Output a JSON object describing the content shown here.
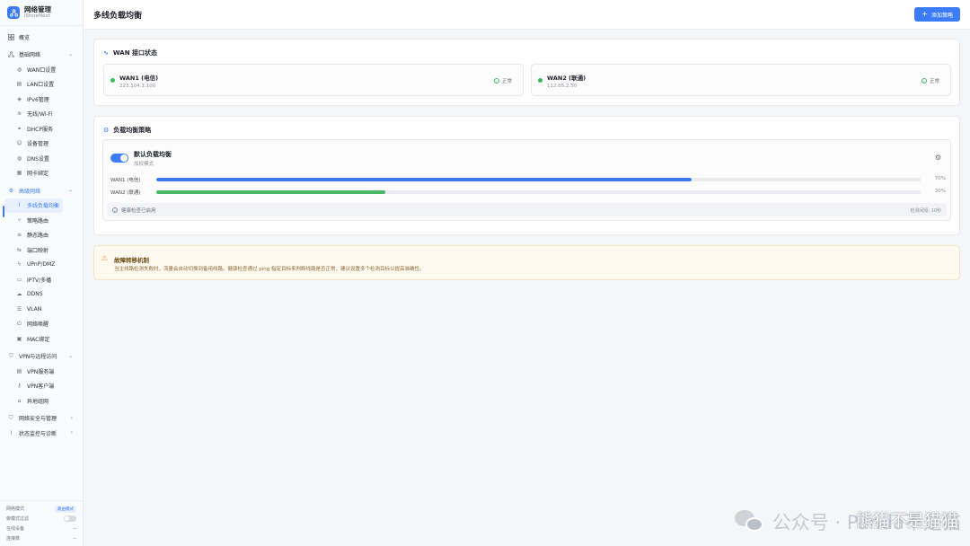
{
  "brand": {
    "title": "网络管理",
    "subtitle": "iStoreNext"
  },
  "sidebar": {
    "overview": "概览",
    "basic": {
      "label": "基础网络",
      "items": [
        "WAN口设置",
        "LAN口设置",
        "IPv6管理",
        "无线/Wi-Fi",
        "DHCP服务",
        "设备管理",
        "DNS设置",
        "网卡绑定"
      ]
    },
    "advanced": {
      "label": "高级网络",
      "items": [
        "多线负载均衡",
        "策略路由",
        "静态路由",
        "端口映射",
        "UPnP/DMZ",
        "IPTV/多播",
        "DDNS",
        "VLAN",
        "网络唤醒",
        "MAC绑定"
      ]
    },
    "vpn": {
      "label": "VPN与远程访问",
      "items": [
        "VPN服务端",
        "VPN客户端",
        "异地组网"
      ]
    },
    "security": {
      "label": "网络安全与管理"
    },
    "monitor": {
      "label": "状态监控与诊断"
    }
  },
  "sidebar_footer": {
    "mode_label": "网络模式",
    "mode_value": "路由模式",
    "hw_label": "旁模式过滤",
    "online_label": "在线设备",
    "online_value": "--",
    "conn_label": "连接数",
    "conn_value": "--"
  },
  "header": {
    "title": "多线负载均衡",
    "add_button": "添加策略"
  },
  "wan_section": {
    "title": "WAN 接口状态",
    "interfaces": [
      {
        "name": "WAN1 (电信)",
        "ip": "223.104.1.100",
        "status": "正常"
      },
      {
        "name": "WAN2 (联通)",
        "ip": "112.65.2.50",
        "status": "正常"
      }
    ]
  },
  "policy_section": {
    "title": "负载均衡策略",
    "policy": {
      "name": "默认负载均衡",
      "mode": "加权模式",
      "enabled": true,
      "weights": [
        {
          "label": "WAN1 (电信)",
          "percent_text": "70%",
          "fraction": 0.7,
          "color": "#3b7cf6"
        },
        {
          "label": "WAN2 (联通)",
          "percent_text": "30%",
          "fraction": 0.3,
          "color": "#47b865"
        }
      ],
      "health_text": "健康检查已启用",
      "interval_text": "检测间隔: 10秒"
    }
  },
  "alert": {
    "title": "故障转移机制",
    "desc": "当主线路检测失败时，流量会自动切换到备用线路。健康检查通过 ping 指定目标来判断线路是否正常，建议设置多个检测目标以提高准确性。"
  },
  "watermark": {
    "text": "公众号 · Panda不是猫",
    "sub": "熊猫不是猫猫"
  }
}
